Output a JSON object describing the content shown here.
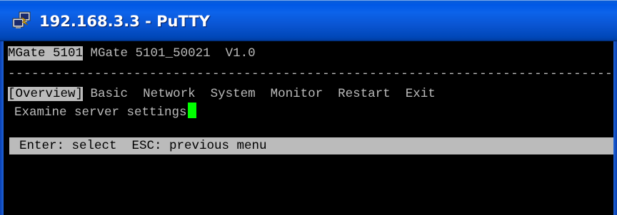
{
  "window": {
    "title": "192.168.3.3 - PuTTY"
  },
  "terminal": {
    "header": {
      "model": "MGate 5101",
      "info": "MGate 5101_50021  V1.0"
    },
    "separator": "----------------------------------------------------------------------------------------------------",
    "menu": {
      "selected": "[Overview]",
      "items": [
        "Basic",
        "Network",
        "System",
        "Monitor",
        "Restart",
        "Exit"
      ]
    },
    "description": "Examine server settings",
    "status": "Enter: select  ESC: previous menu"
  },
  "colors": {
    "titlebar": "#0058e6",
    "terminal_bg": "#000000",
    "terminal_text": "#bbbbbb",
    "cursor": "#00ff00"
  },
  "icons": {
    "app": "putty-icon"
  }
}
